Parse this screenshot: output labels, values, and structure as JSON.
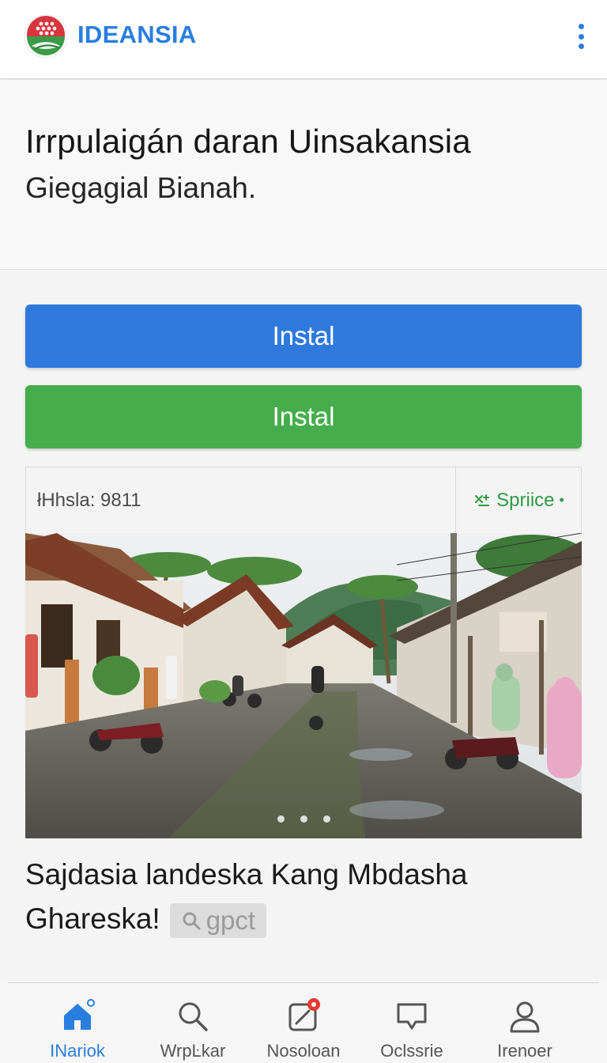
{
  "app_bar": {
    "brand": "IDEANSIA",
    "logo_icon": "ideansia-logo",
    "menu_icon": "more-vertical-icon"
  },
  "hero": {
    "title": "Irrpulaigán daran Uinsakansia",
    "subtitle": "Giegagial Bianah."
  },
  "buttons": {
    "primary_label": "Instal",
    "secondary_label": "Instal"
  },
  "info_bar": {
    "left_text": "łHhsla: 9811",
    "right_text": "Spriice",
    "right_icon": "settings-icon"
  },
  "carousel": {
    "slide_count": 3,
    "active_index": 0
  },
  "caption": {
    "text": "Sajdasia Ɩandeska Kang Mbdasha Ghareska!",
    "tag_label": "gpct",
    "tag_icon": "search-icon"
  },
  "bottom_nav": {
    "items": [
      {
        "label": "INariok",
        "icon": "home-icon",
        "active": true
      },
      {
        "label": "WrpĿkar",
        "icon": "search-icon",
        "active": false
      },
      {
        "label": "Nosoloan",
        "icon": "edit-notification-icon",
        "active": false
      },
      {
        "label": "Oclssrie",
        "icon": "chat-icon",
        "active": false
      },
      {
        "label": "Irenoer",
        "icon": "profile-icon",
        "active": false
      }
    ]
  },
  "colors": {
    "brand_blue": "#2a7ee0",
    "primary_button": "#2f79dd",
    "secondary_button": "#45ad4b",
    "badge_red": "#e53935"
  }
}
